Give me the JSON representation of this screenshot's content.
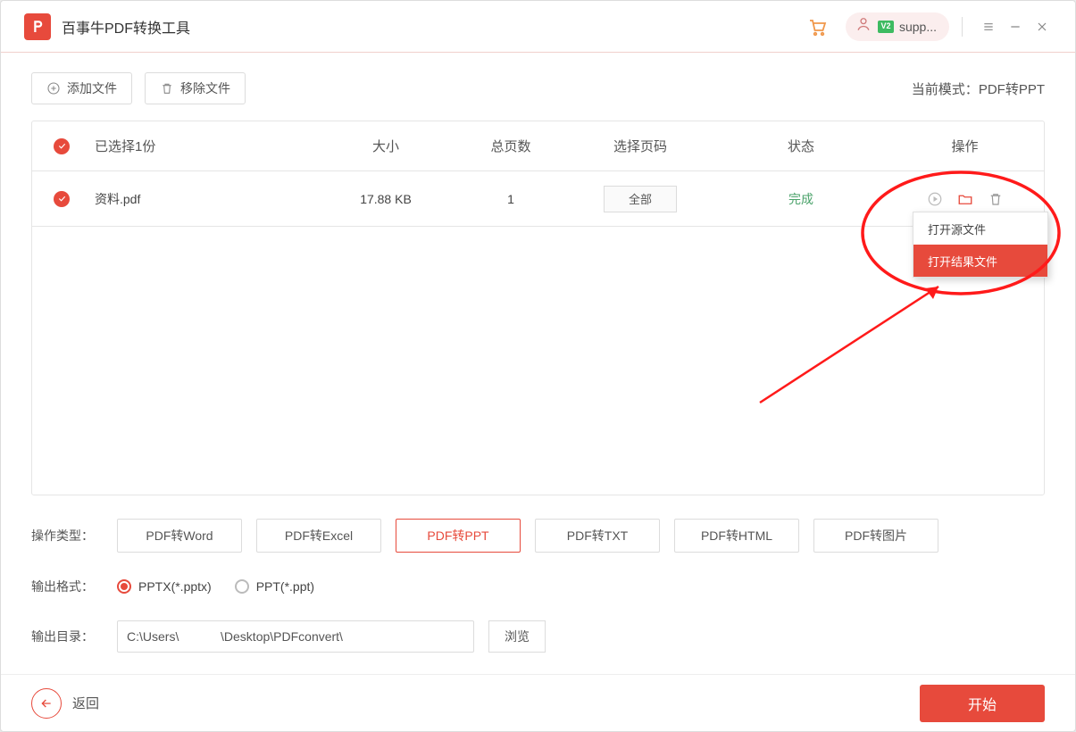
{
  "titlebar": {
    "app_name": "百事牛PDF转换工具",
    "user_name": "supp...",
    "vip_badge": "V2"
  },
  "toolbar": {
    "add_file": "添加文件",
    "remove_file": "移除文件",
    "mode_prefix": "当前模式：",
    "mode_value": "PDF转PPT"
  },
  "table": {
    "headers": {
      "selected": "已选择1份",
      "size": "大小",
      "pages": "总页数",
      "select_pages": "选择页码",
      "status": "状态",
      "ops": "操作"
    },
    "rows": [
      {
        "name": "资料.pdf",
        "size": "17.88 KB",
        "pages": "1",
        "select_label": "全部",
        "status": "完成"
      }
    ]
  },
  "context_menu": {
    "open_source": "打开源文件",
    "open_result": "打开结果文件"
  },
  "options": {
    "type_label": "操作类型：",
    "tabs": [
      "PDF转Word",
      "PDF转Excel",
      "PDF转PPT",
      "PDF转TXT",
      "PDF转HTML",
      "PDF转图片"
    ],
    "active_tab": 2,
    "format_label": "输出格式：",
    "formats": [
      "PPTX(*.pptx)",
      "PPT(*.ppt)"
    ],
    "format_selected": 0,
    "output_label": "输出目录：",
    "output_path": "C:\\Users\\            \\Desktop\\PDFconvert\\",
    "browse": "浏览"
  },
  "footer": {
    "back": "返回",
    "start": "开始"
  }
}
